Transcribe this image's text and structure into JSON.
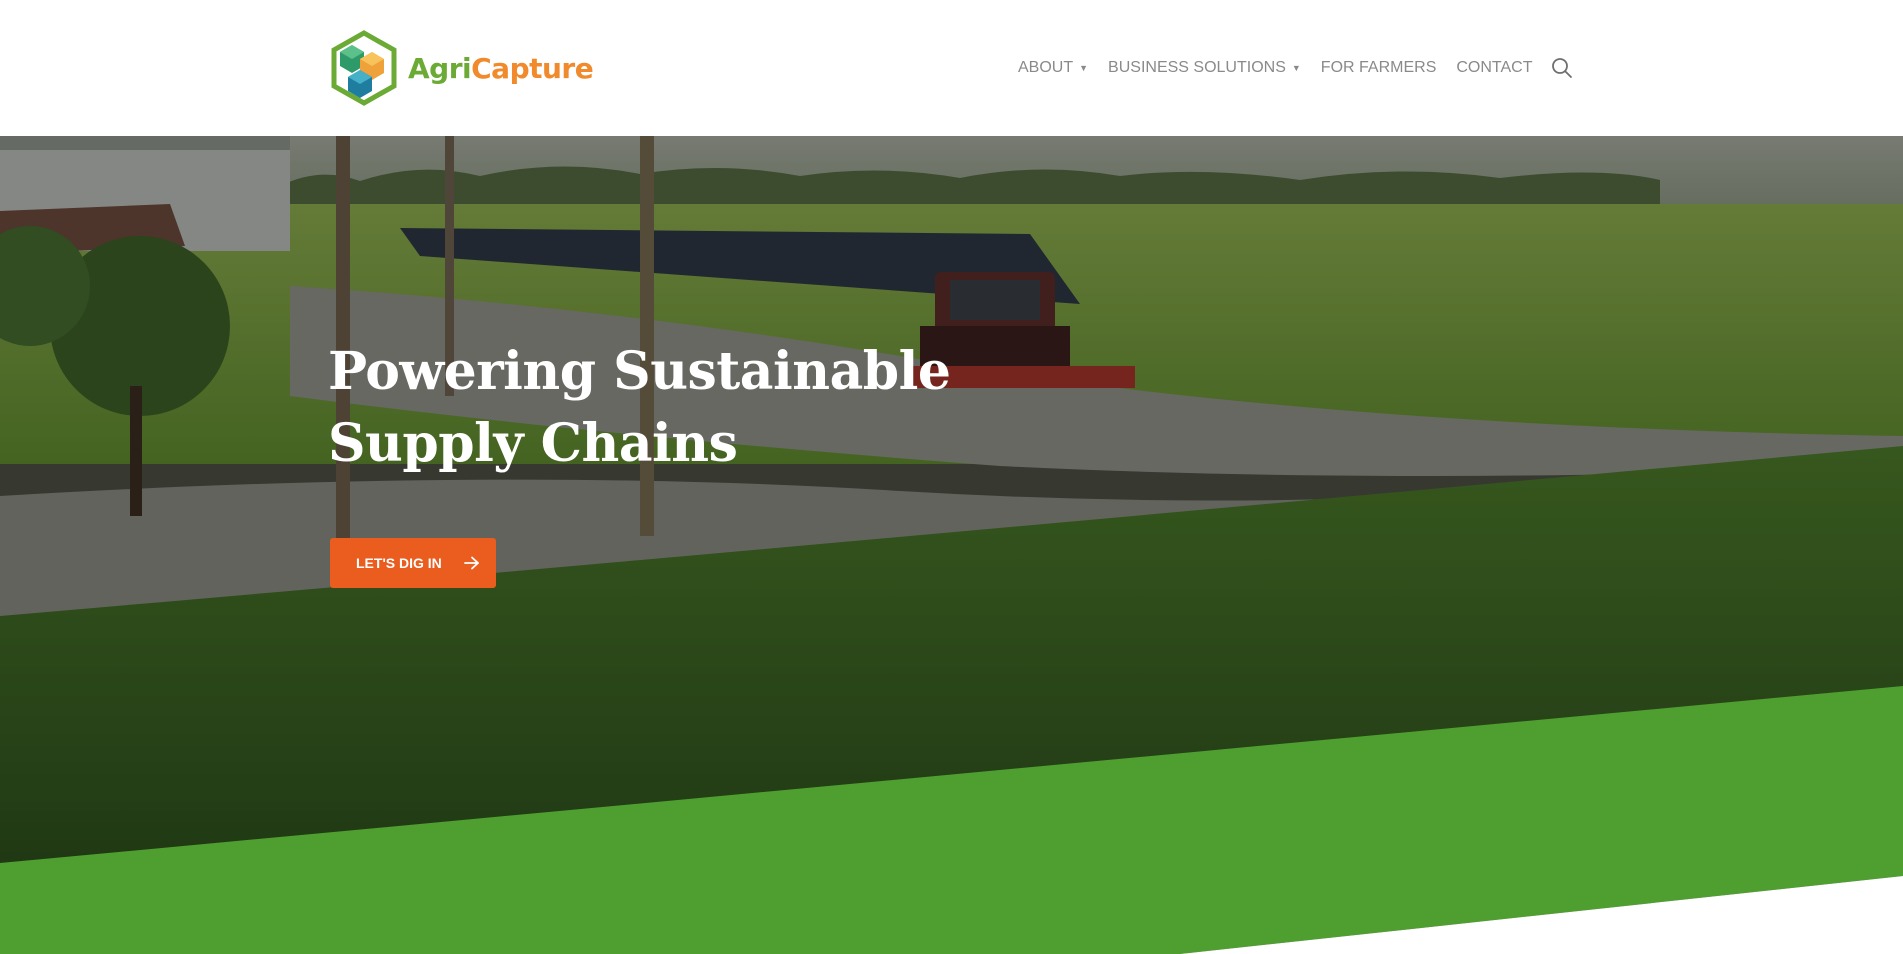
{
  "brand": {
    "name_part1": "Agri",
    "name_part2": "Capture",
    "logo_icon": "hexagon-cubes-icon",
    "colors": {
      "green": "#6aaa35",
      "orange": "#f08a2c"
    }
  },
  "nav": {
    "items": [
      {
        "label": "ABOUT",
        "has_dropdown": true
      },
      {
        "label": "BUSINESS SOLUTIONS",
        "has_dropdown": true
      },
      {
        "label": "FOR FARMERS",
        "has_dropdown": false
      },
      {
        "label": "CONTACT",
        "has_dropdown": false
      }
    ],
    "dropdown_glyph": "▼",
    "search_icon": "search-icon"
  },
  "hero": {
    "title_line1": "Powering Sustainable",
    "title_line2": "Supply Chains",
    "cta_label": "LET'S DIG IN",
    "cta_icon": "arrow-right-icon",
    "colors": {
      "cta": "#ea5d1e",
      "band": "#4e9f30"
    }
  }
}
